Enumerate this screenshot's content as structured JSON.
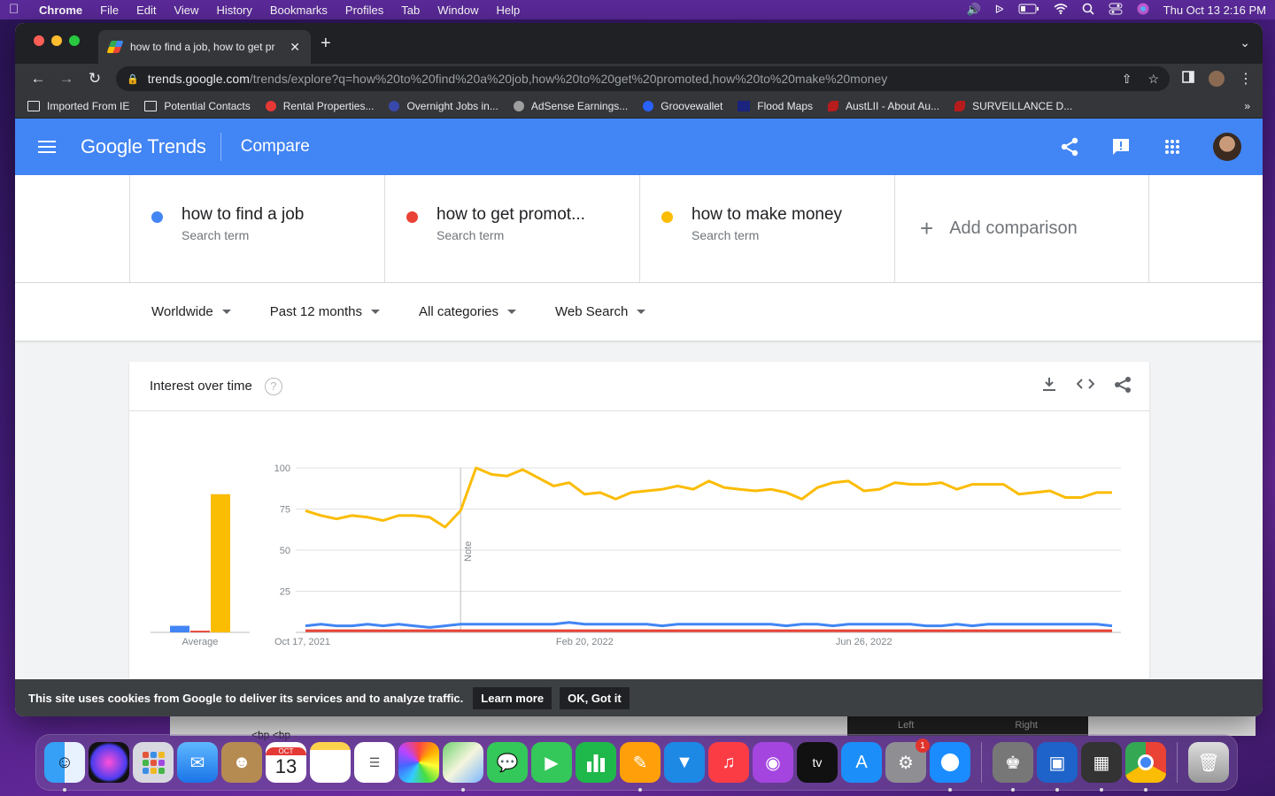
{
  "menubar": {
    "app": "Chrome",
    "items": [
      "File",
      "Edit",
      "View",
      "History",
      "Bookmarks",
      "Profiles",
      "Tab",
      "Window",
      "Help"
    ],
    "clock": "Thu Oct 13  2:16 PM"
  },
  "browser": {
    "tab_title": "how to find a job, how to get pr",
    "url_host": "trends.google.com",
    "url_path": "/trends/explore?q=how%20to%20find%20a%20job,how%20to%20get%20promoted,how%20to%20make%20money",
    "bookmarks": [
      "Imported From IE",
      "Potential Contacts",
      "Rental Properties...",
      "Overnight Jobs in...",
      "AdSense Earnings...",
      "Groovewallet",
      "Flood Maps",
      "AustLII - About Au...",
      "SURVEILLANCE D..."
    ]
  },
  "header": {
    "logo_google": "Google",
    "logo_trends": "Trends",
    "page": "Compare"
  },
  "terms": [
    {
      "name": "how to find a job",
      "sub": "Search term",
      "color": "#4285f4"
    },
    {
      "name": "how to get promot...",
      "sub": "Search term",
      "color": "#ea4335"
    },
    {
      "name": "how to make money",
      "sub": "Search term",
      "color": "#fbbc04"
    }
  ],
  "add_comparison": "Add comparison",
  "filters": [
    "Worldwide",
    "Past 12 months",
    "All categories",
    "Web Search"
  ],
  "card": {
    "title": "Interest over time",
    "help": "?"
  },
  "chart_data": {
    "type": "line",
    "ylim": [
      0,
      100
    ],
    "yticks": [
      25,
      50,
      75,
      100
    ],
    "x_tick_labels": [
      "Oct 17, 2021",
      "Feb 20, 2022",
      "Jun 26, 2022"
    ],
    "average_label": "Average",
    "note_label": "Note",
    "averages": [
      4,
      1,
      84
    ],
    "series": [
      {
        "name": "how to find a job",
        "color": "#4285f4",
        "values": [
          4,
          5,
          4,
          4,
          5,
          4,
          5,
          4,
          3,
          4,
          5,
          5,
          5,
          5,
          5,
          5,
          5,
          6,
          5,
          5,
          5,
          5,
          5,
          4,
          5,
          5,
          5,
          5,
          5,
          5,
          5,
          4,
          5,
          5,
          4,
          5,
          5,
          5,
          5,
          5,
          4,
          4,
          5,
          4,
          5,
          5,
          5,
          5,
          5,
          5,
          5,
          5,
          4
        ]
      },
      {
        "name": "how to get promoted",
        "color": "#ea4335",
        "values": [
          1,
          1,
          1,
          1,
          1,
          1,
          1,
          1,
          1,
          1,
          1,
          1,
          1,
          1,
          1,
          1,
          1,
          1,
          1,
          1,
          1,
          1,
          1,
          1,
          1,
          1,
          1,
          1,
          1,
          1,
          1,
          1,
          1,
          1,
          1,
          1,
          1,
          1,
          1,
          1,
          1,
          1,
          1,
          1,
          1,
          1,
          1,
          1,
          1,
          1,
          1,
          1,
          1
        ]
      },
      {
        "name": "how to make money",
        "color": "#fbbc04",
        "values": [
          74,
          71,
          69,
          71,
          70,
          68,
          71,
          71,
          70,
          64,
          74,
          100,
          96,
          95,
          99,
          94,
          89,
          91,
          84,
          85,
          81,
          85,
          86,
          87,
          89,
          87,
          92,
          88,
          87,
          86,
          87,
          85,
          81,
          88,
          91,
          92,
          86,
          87,
          91,
          90,
          90,
          91,
          87,
          90,
          90,
          90,
          84,
          85,
          86,
          82,
          82,
          85,
          85
        ]
      }
    ]
  },
  "cookie": {
    "text": "This site uses cookies from Google to deliver its services and to analyze traffic.",
    "learn": "Learn more",
    "ok": "OK, Got it"
  },
  "background_window": {
    "left_label": "Left",
    "right_label": "Right",
    "text": "<bp <bp"
  },
  "dock": {
    "calendar_month": "OCT",
    "calendar_day": "13",
    "settings_badge": "1"
  }
}
